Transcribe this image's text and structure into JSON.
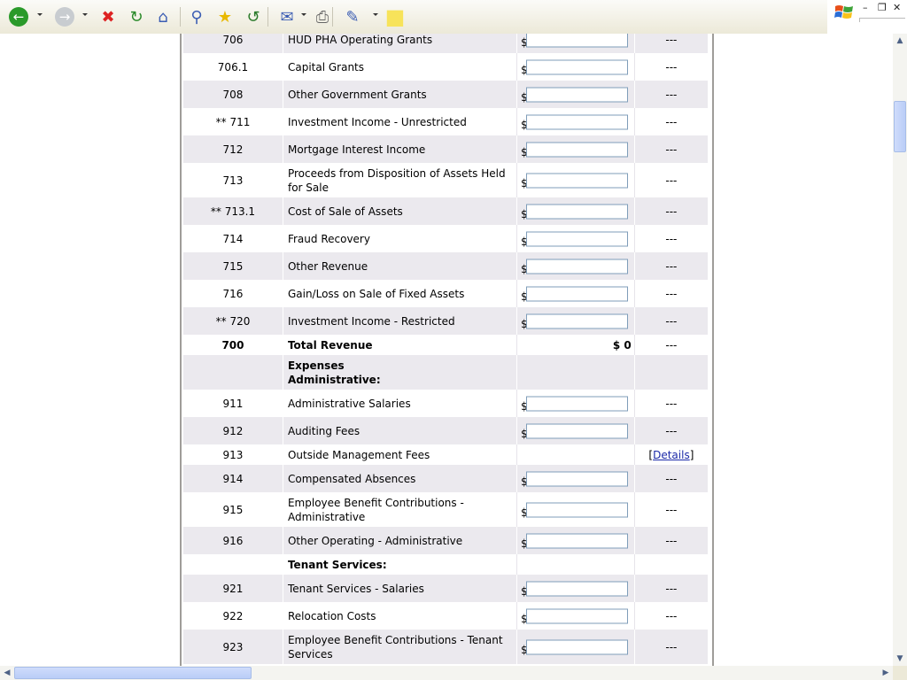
{
  "toolbar": {
    "buttons": [
      {
        "name": "back-icon",
        "glyph": "←",
        "color": "#2a9a2a"
      },
      {
        "name": "forward-icon",
        "glyph": "→",
        "color": "#9aa0a6"
      },
      {
        "name": "stop-icon",
        "glyph": "✖",
        "color": "#d22"
      },
      {
        "name": "refresh-icon",
        "glyph": "↻",
        "color": "#2a8a2a"
      },
      {
        "name": "home-icon",
        "glyph": "⌂",
        "color": "#3b5db3"
      },
      {
        "name": "search-icon",
        "glyph": "⚲",
        "color": "#3b5db3"
      },
      {
        "name": "favorites-icon",
        "glyph": "★",
        "color": "#e8b800"
      },
      {
        "name": "history-icon",
        "glyph": "↺",
        "color": "#2a7a2a"
      },
      {
        "name": "mail-icon",
        "glyph": "✉",
        "color": "#3b5db3"
      },
      {
        "name": "print-icon",
        "glyph": "⎙",
        "color": "#666"
      },
      {
        "name": "edit-icon",
        "glyph": "✎",
        "color": "#3b5db3"
      },
      {
        "name": "note-icon",
        "glyph": "■",
        "color": "#f7e35a"
      }
    ]
  },
  "rows": [
    {
      "code": "706",
      "desc": "HUD PHA Operating Grants",
      "type": "input",
      "note": "---",
      "shade": "g"
    },
    {
      "code": "706.1",
      "desc": "Capital Grants",
      "type": "input",
      "note": "---",
      "shade": "w"
    },
    {
      "code": "708",
      "desc": "Other Government Grants",
      "type": "input",
      "note": "---",
      "shade": "g"
    },
    {
      "code": "** 711",
      "desc": "Investment Income - Unrestricted",
      "type": "input",
      "note": "---",
      "shade": "w"
    },
    {
      "code": "712",
      "desc": "Mortgage Interest Income",
      "type": "input",
      "note": "---",
      "shade": "g"
    },
    {
      "code": "713",
      "desc": "Proceeds from Disposition of Assets Held for Sale",
      "type": "input",
      "note": "---",
      "shade": "w",
      "tall": true
    },
    {
      "code": "** 713.1",
      "desc": "Cost of Sale of Assets",
      "type": "input",
      "note": "---",
      "shade": "g"
    },
    {
      "code": "714",
      "desc": "Fraud Recovery",
      "type": "input",
      "note": "---",
      "shade": "w"
    },
    {
      "code": "715",
      "desc": "Other Revenue",
      "type": "input",
      "note": "---",
      "shade": "g"
    },
    {
      "code": "716",
      "desc": "Gain/Loss on Sale of Fixed Assets",
      "type": "input",
      "note": "---",
      "shade": "w"
    },
    {
      "code": "** 720",
      "desc": "Investment Income - Restricted",
      "type": "input",
      "note": "---",
      "shade": "g"
    },
    {
      "code": "700",
      "desc": "Total Revenue",
      "type": "total",
      "value": "$ 0",
      "note": "---",
      "shade": "w",
      "bold": true
    },
    {
      "code": "",
      "desc": "Expenses\nAdministrative:",
      "type": "header",
      "note": "",
      "shade": "g",
      "bold": true,
      "tall": true
    },
    {
      "code": "911",
      "desc": "Administrative Salaries",
      "type": "input",
      "note": "---",
      "shade": "w"
    },
    {
      "code": "912",
      "desc": "Auditing Fees",
      "type": "input",
      "note": "---",
      "shade": "g"
    },
    {
      "code": "913",
      "desc": "Outside Management Fees",
      "type": "link",
      "note": "Details",
      "shade": "w"
    },
    {
      "code": "914",
      "desc": "Compensated Absences",
      "type": "input",
      "note": "---",
      "shade": "g"
    },
    {
      "code": "915",
      "desc": "Employee Benefit Contributions - Administrative",
      "type": "input",
      "note": "---",
      "shade": "w",
      "tall": true
    },
    {
      "code": "916",
      "desc": "Other Operating - Administrative",
      "type": "input",
      "note": "---",
      "shade": "g"
    },
    {
      "code": "",
      "desc": "Tenant Services:",
      "type": "header",
      "note": "",
      "shade": "w",
      "bold": true
    },
    {
      "code": "921",
      "desc": "Tenant Services - Salaries",
      "type": "input",
      "note": "---",
      "shade": "g"
    },
    {
      "code": "922",
      "desc": "Relocation Costs",
      "type": "input",
      "note": "---",
      "shade": "w"
    },
    {
      "code": "923",
      "desc": "Employee Benefit Contributions - Tenant Services",
      "type": "input",
      "note": "---",
      "shade": "g",
      "tall": true
    }
  ]
}
